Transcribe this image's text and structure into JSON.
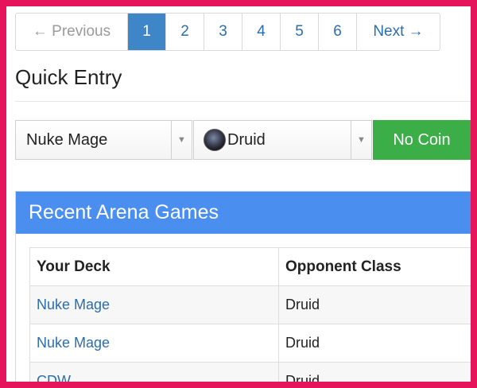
{
  "pagination": {
    "previous": "← Previous",
    "pages": [
      "1",
      "2",
      "3",
      "4",
      "5",
      "6"
    ],
    "active_page": "1",
    "next": "Next →"
  },
  "quick_entry": {
    "title": "Quick Entry",
    "deck_select": {
      "value": "Nuke Mage",
      "icon": "chevron-down-icon"
    },
    "class_select": {
      "value": "Druid",
      "icon": "druid-portrait-icon"
    },
    "coin_button": "No Coin"
  },
  "recent_games": {
    "title": "Recent Arena Games",
    "columns": [
      "Your Deck",
      "Opponent Class"
    ],
    "rows": [
      {
        "deck": "Nuke Mage",
        "opponent": "Druid"
      },
      {
        "deck": "Nuke Mage",
        "opponent": "Druid"
      },
      {
        "deck": "CDW",
        "opponent": "Druid"
      }
    ]
  },
  "colors": {
    "active_page": "#3f86c8",
    "link": "#2a6db0",
    "coin_button": "#3cae48",
    "panel_header": "#4a8ef0",
    "frame": "#e6145a"
  }
}
